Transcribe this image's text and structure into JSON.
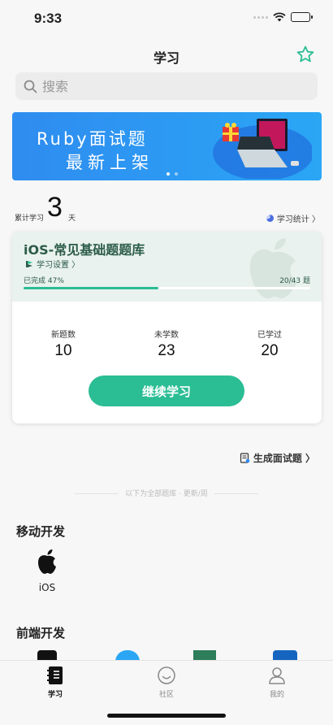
{
  "status": {
    "time": "9:33"
  },
  "nav": {
    "title": "学习"
  },
  "search": {
    "placeholder": "搜索"
  },
  "banner": {
    "line1": "Ruby面试题",
    "line2": "最新上架"
  },
  "study": {
    "days_label": "累计学习",
    "days": "3",
    "days_unit": "天",
    "stats_label": "学习统计 〉"
  },
  "library": {
    "title": "iOS-常见基础题题库",
    "settings_label": "学习设置 〉",
    "progress_text": "已完成 47%",
    "progress_count": "20/43 题",
    "progress_fraction": 0.47,
    "stats": [
      {
        "label": "新题数",
        "value": "10"
      },
      {
        "label": "未学数",
        "value": "23"
      },
      {
        "label": "已学过",
        "value": "20"
      }
    ],
    "continue_label": "继续学习"
  },
  "generate": {
    "label": "生成面试题 〉"
  },
  "divider": {
    "text": "以下为全部题库 · 更新/周"
  },
  "sections": [
    {
      "title": "移动开发",
      "items": [
        {
          "label": "iOS",
          "icon": "apple-icon"
        }
      ]
    },
    {
      "title": "前端开发"
    }
  ],
  "tabs": [
    {
      "label": "学习",
      "icon": "notebook-icon"
    },
    {
      "label": "社区",
      "icon": "smiley-icon"
    },
    {
      "label": "我的",
      "icon": "person-icon"
    }
  ],
  "colors": {
    "accent": "#2bbd94",
    "banner": "#2f8cf0",
    "card_header": "#e9f2ee",
    "star": "#2bbd94"
  }
}
